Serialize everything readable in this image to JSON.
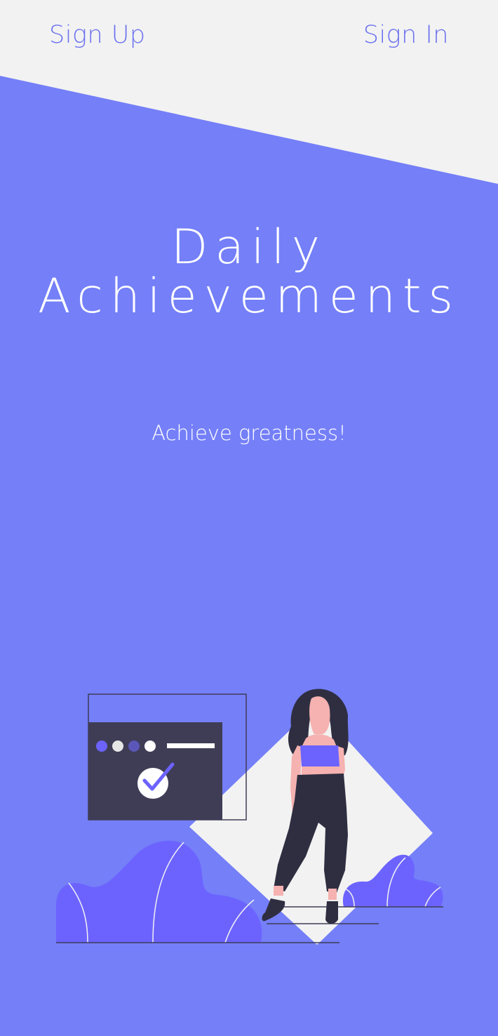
{
  "nav": {
    "sign_up_label": "Sign Up",
    "sign_in_label": "Sign In"
  },
  "hero": {
    "title_line1": "Daily",
    "title_line2": "Achievements",
    "tagline": "Achieve greatness!"
  },
  "colors": {
    "background": "#747ff8",
    "header_band": "#f2f2f2",
    "accent": "#6b72ef",
    "dark": "#3f3d56",
    "text": "#ffffff"
  },
  "illustration": {
    "name": "woman-with-checklist-window-illustration"
  }
}
